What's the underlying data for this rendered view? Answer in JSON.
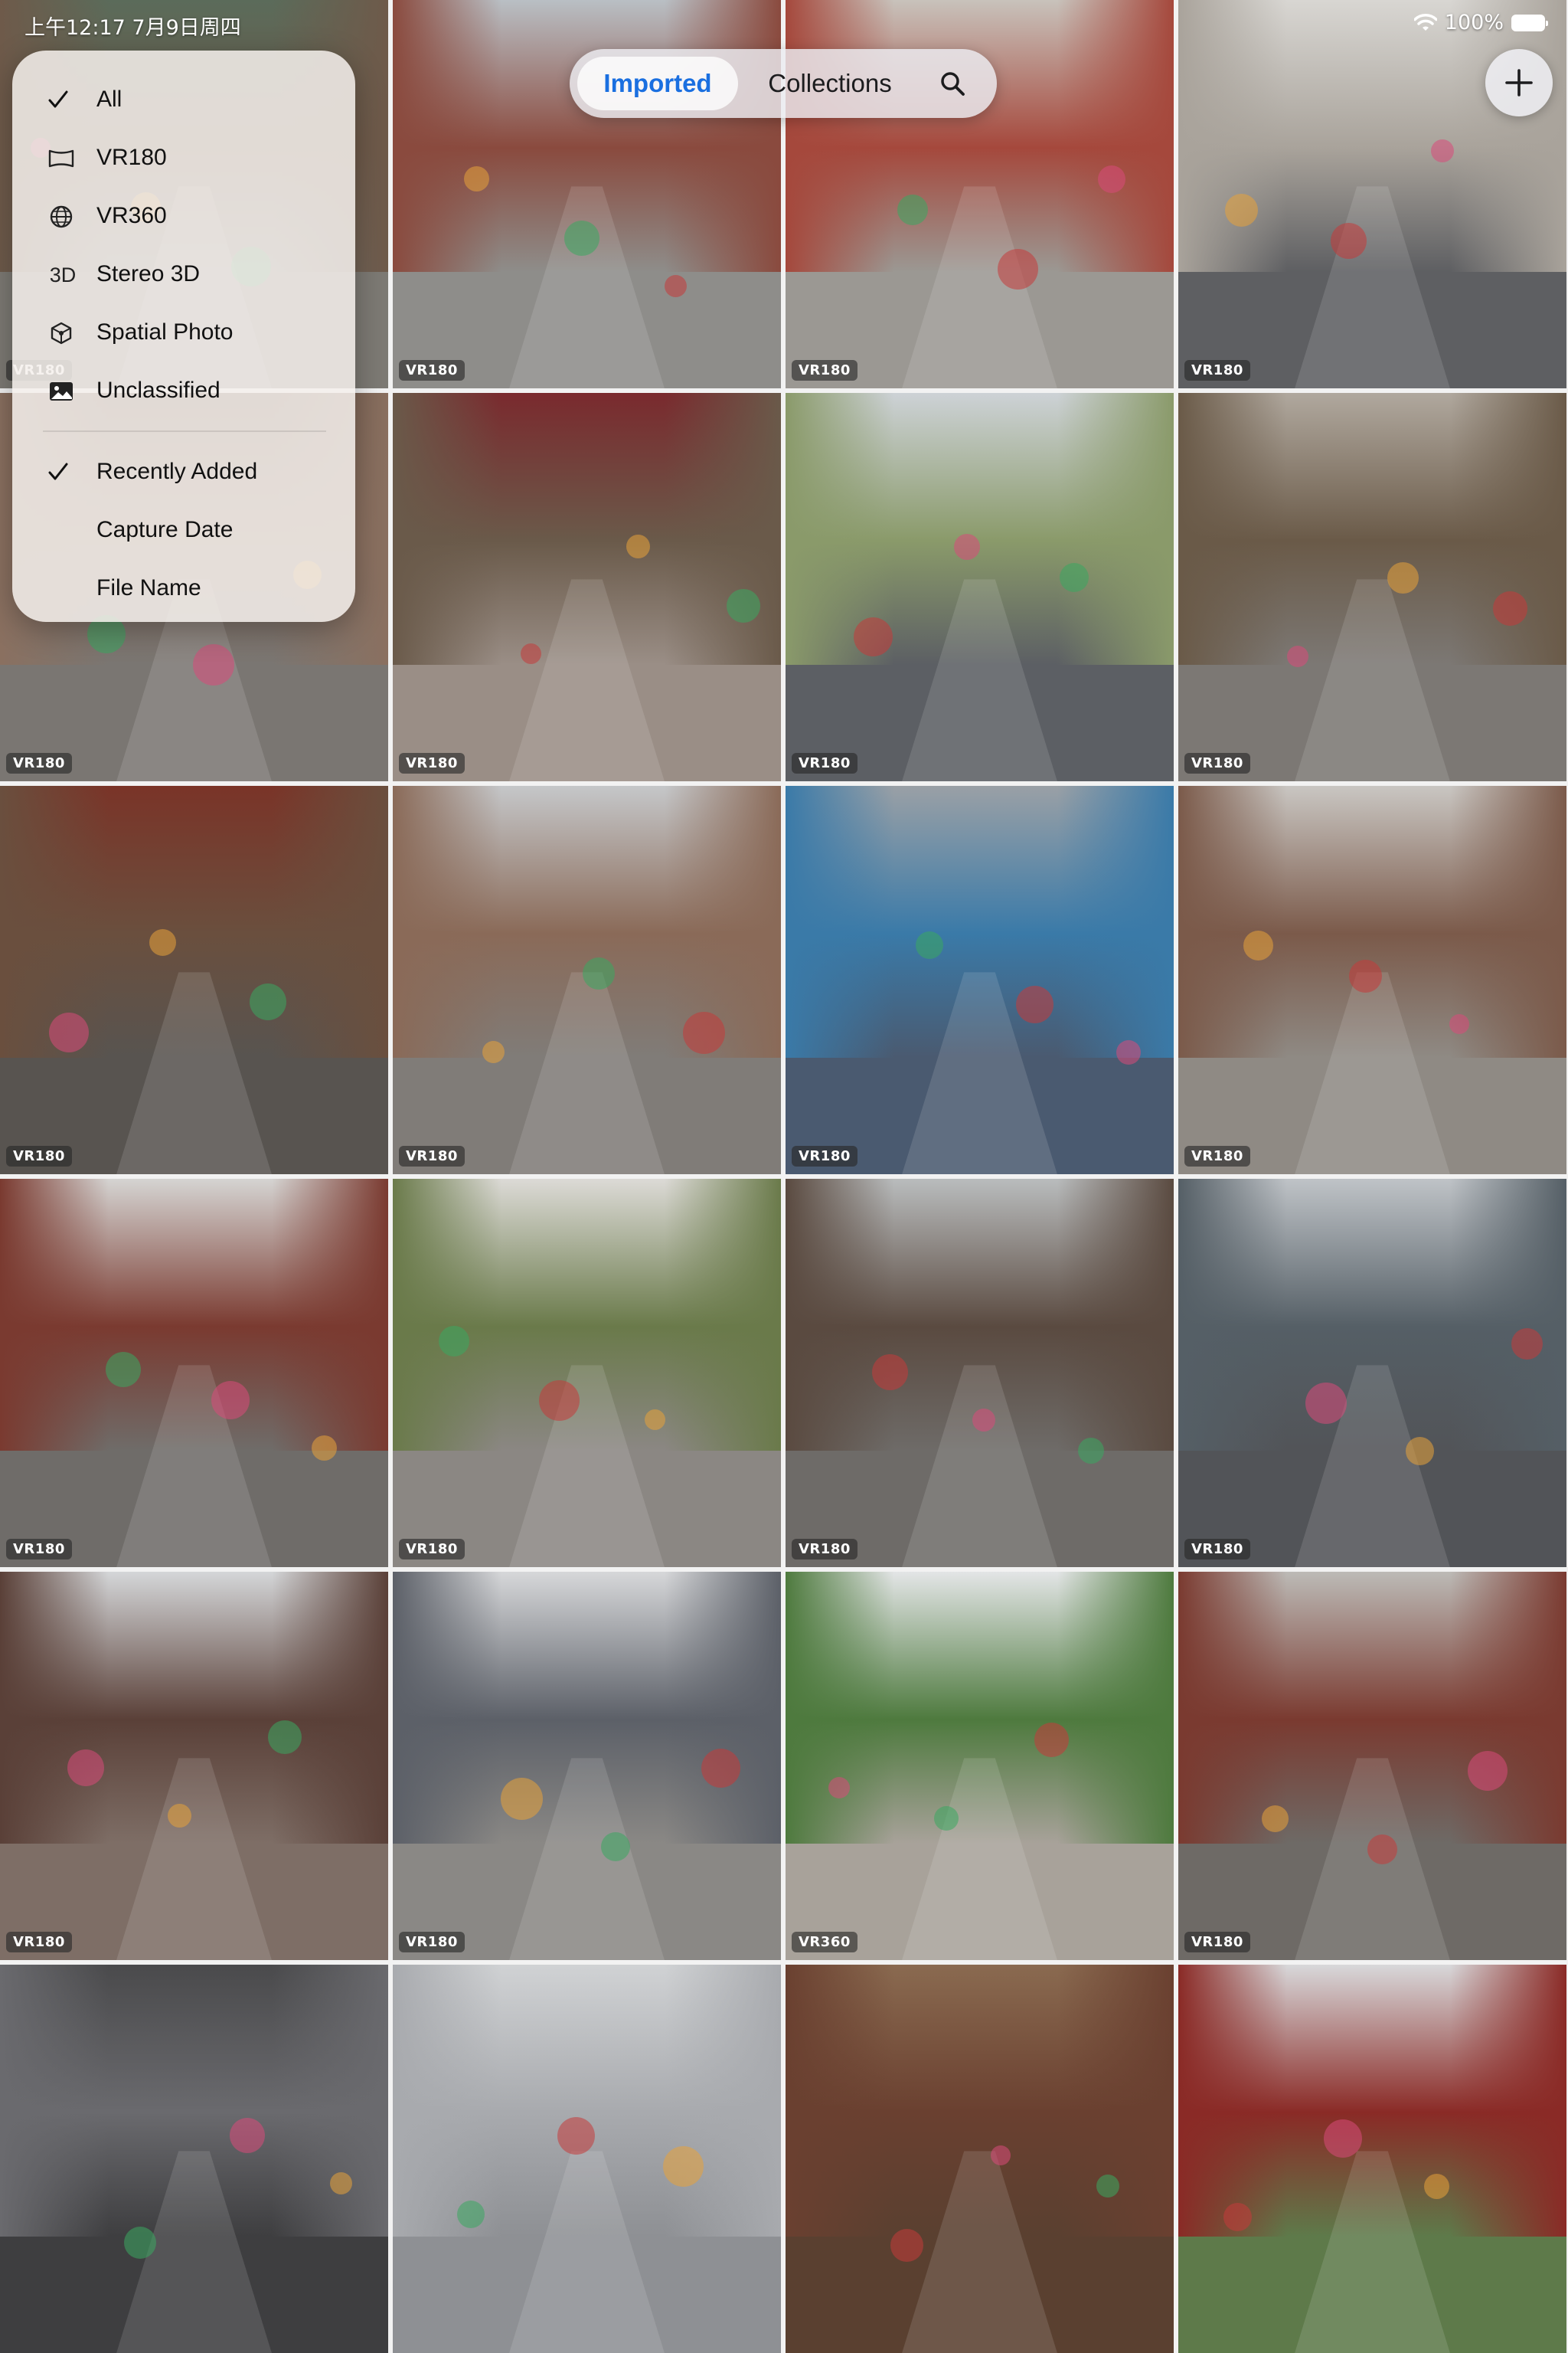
{
  "status_bar": {
    "time_date": "上午12:17  7月9日周四",
    "battery": "100%"
  },
  "segmented": {
    "imported": "Imported",
    "collections": "Collections"
  },
  "menu": {
    "filters": [
      {
        "label": "All",
        "icon": "checkmark-icon",
        "checked": true
      },
      {
        "label": "VR180",
        "icon": "vr180-icon"
      },
      {
        "label": "VR360",
        "icon": "globe-icon"
      },
      {
        "label": "Stereo 3D",
        "icon_text": "3D"
      },
      {
        "label": "Spatial Photo",
        "icon": "cube-icon"
      },
      {
        "label": "Unclassified",
        "icon": "photo-icon"
      }
    ],
    "sort": [
      {
        "label": "Recently Added",
        "checked": true
      },
      {
        "label": "Capture Date"
      },
      {
        "label": "File Name"
      }
    ]
  },
  "grid": {
    "tiles": [
      {
        "badge": "VR180",
        "colors": [
          "#5b6b5a",
          "#6e5a4a",
          "#7d7a74"
        ]
      },
      {
        "badge": "VR180",
        "colors": [
          "#b9bfc4",
          "#8a4a3e",
          "#8e8d8a"
        ]
      },
      {
        "badge": "VR180",
        "colors": [
          "#c8c2bb",
          "#a5483c",
          "#9b9893"
        ]
      },
      {
        "badge": "VR180",
        "colors": [
          "#d8d6d2",
          "#a9a39b",
          "#5e5f62"
        ]
      },
      {
        "badge": "VR180",
        "colors": [
          "#6b5548",
          "#8a7060",
          "#7a7672"
        ]
      },
      {
        "badge": "VR180",
        "colors": [
          "#7a2a2e",
          "#6a5a4a",
          "#9a8e86"
        ]
      },
      {
        "badge": "VR180",
        "colors": [
          "#cdd2d6",
          "#8a9a6a",
          "#5c5f64"
        ]
      },
      {
        "badge": "VR180",
        "colors": [
          "#b0a89e",
          "#6a5a48",
          "#7c7874"
        ]
      },
      {
        "badge": "VR180",
        "colors": [
          "#7a3428",
          "#6a4f3e",
          "#585450"
        ]
      },
      {
        "badge": "VR180",
        "colors": [
          "#c5c7c9",
          "#8a6a58",
          "#807c78"
        ]
      },
      {
        "badge": "VR180",
        "colors": [
          "#9aa0a6",
          "#3a7aa8",
          "#4a5a70"
        ]
      },
      {
        "badge": "VR180",
        "colors": [
          "#c9c6c2",
          "#7b5a4a",
          "#8f8a84"
        ]
      },
      {
        "badge": "VR180",
        "colors": [
          "#d5d4d2",
          "#7a3a30",
          "#6f6c69"
        ]
      },
      {
        "badge": "VR180",
        "colors": [
          "#dcdad6",
          "#6a7a4a",
          "#8b8783"
        ]
      },
      {
        "badge": "VR180",
        "colors": [
          "#b9bcbd",
          "#5a4a40",
          "#6e6b68"
        ]
      },
      {
        "badge": "VR180",
        "colors": [
          "#bfc3c7",
          "#555f66",
          "#525458"
        ]
      },
      {
        "badge": "VR180",
        "colors": [
          "#d4d6d8",
          "#5a4038",
          "#7e6e66"
        ]
      },
      {
        "badge": "VR180",
        "colors": [
          "#d6d7d9",
          "#5c6068",
          "#8a8885"
        ]
      },
      {
        "badge": "VR360",
        "colors": [
          "#e3e5e6",
          "#4e7a3e",
          "#a8a29a"
        ]
      },
      {
        "badge": "VR180",
        "colors": [
          "#bcbab6",
          "#7a3a30",
          "#6e6a66"
        ]
      },
      {
        "badge": "",
        "colors": [
          "#4a4a4c",
          "#6a6a6e",
          "#3e3e40"
        ]
      },
      {
        "badge": "",
        "colors": [
          "#d0d2d4",
          "#a8aaae",
          "#8e9094"
        ]
      },
      {
        "badge": "",
        "colors": [
          "#8a6a50",
          "#6a4030",
          "#5a4030"
        ]
      },
      {
        "badge": "",
        "colors": [
          "#d8d8da",
          "#8a2a26",
          "#5e7a4a"
        ]
      }
    ]
  }
}
